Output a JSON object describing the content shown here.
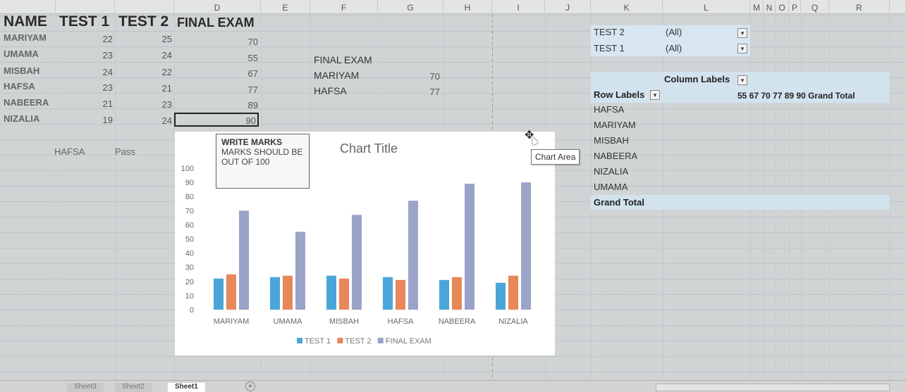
{
  "columns": {
    "d": "D",
    "e": "E",
    "f": "F",
    "g": "G",
    "h": "H",
    "i": "I",
    "j": "J",
    "k": "K",
    "l": "L",
    "m": "M",
    "n": "N",
    "o": "O",
    "p": "P",
    "q": "Q",
    "r": "R"
  },
  "table": {
    "headers": [
      "NAME",
      "TEST 1",
      "TEST 2",
      "FINAL EXAM"
    ],
    "rows": [
      {
        "name": "MARIYAM",
        "t1": "22",
        "t2": "25",
        "final": "70"
      },
      {
        "name": "UMAMA",
        "t1": "23",
        "t2": "24",
        "final": "55"
      },
      {
        "name": "MISBAH",
        "t1": "24",
        "t2": "22",
        "final": "67"
      },
      {
        "name": "HAFSA",
        "t1": "23",
        "t2": "21",
        "final": "77"
      },
      {
        "name": "NABEERA",
        "t1": "21",
        "t2": "23",
        "final": "89"
      },
      {
        "name": "NIZALIA",
        "t1": "19",
        "t2": "24",
        "final": "90"
      }
    ],
    "result_name": "HAFSA",
    "result_value": "Pass"
  },
  "lookup": {
    "header": "FINAL EXAM",
    "rows": [
      {
        "name": "MARIYAM",
        "value": "70"
      },
      {
        "name": "HAFSA",
        "value": "77"
      }
    ]
  },
  "comment": {
    "title": "WRITE MARKS",
    "body_line1": "MARKS SHOULD BE",
    "body_line2": "OUT OF 100"
  },
  "tooltip": "Chart Area",
  "pivot": {
    "filters": [
      {
        "field": "TEST 2",
        "value": "(All)"
      },
      {
        "field": "TEST 1",
        "value": "(All)"
      }
    ],
    "column_labels": "Column Labels",
    "row_labels": "Row Labels",
    "column_values": "55 67 70 77 89 90 Grand Total",
    "rows": [
      "HAFSA",
      "MARIYAM",
      "MISBAH",
      "NABEERA",
      "NIZALIA",
      "UMAMA"
    ],
    "grand_total": "Grand Total"
  },
  "chart_data": {
    "type": "bar",
    "title": "Chart Title",
    "categories": [
      "MARIYAM",
      "UMAMA",
      "MISBAH",
      "HAFSA",
      "NABEERA",
      "NIZALIA"
    ],
    "series": [
      {
        "name": "TEST 1",
        "color": "#4aa6d8",
        "values": [
          22,
          23,
          24,
          23,
          21,
          19
        ]
      },
      {
        "name": "TEST 2",
        "color": "#e8875a",
        "values": [
          25,
          24,
          22,
          21,
          23,
          24
        ]
      },
      {
        "name": "FINAL EXAM",
        "color": "#9aa3c8",
        "values": [
          70,
          55,
          67,
          77,
          89,
          90
        ]
      }
    ],
    "ylim": [
      0,
      100
    ],
    "yticks": [
      0,
      10,
      20,
      30,
      40,
      50,
      60,
      70,
      80,
      90,
      100
    ],
    "legend": "bottom",
    "grid": false
  },
  "sheet_tabs": [
    "Sheet3",
    "Sheet2",
    "Sheet1"
  ],
  "colors": {
    "pivot_blue": "#d2e3ee",
    "chart_title": "#666666"
  }
}
